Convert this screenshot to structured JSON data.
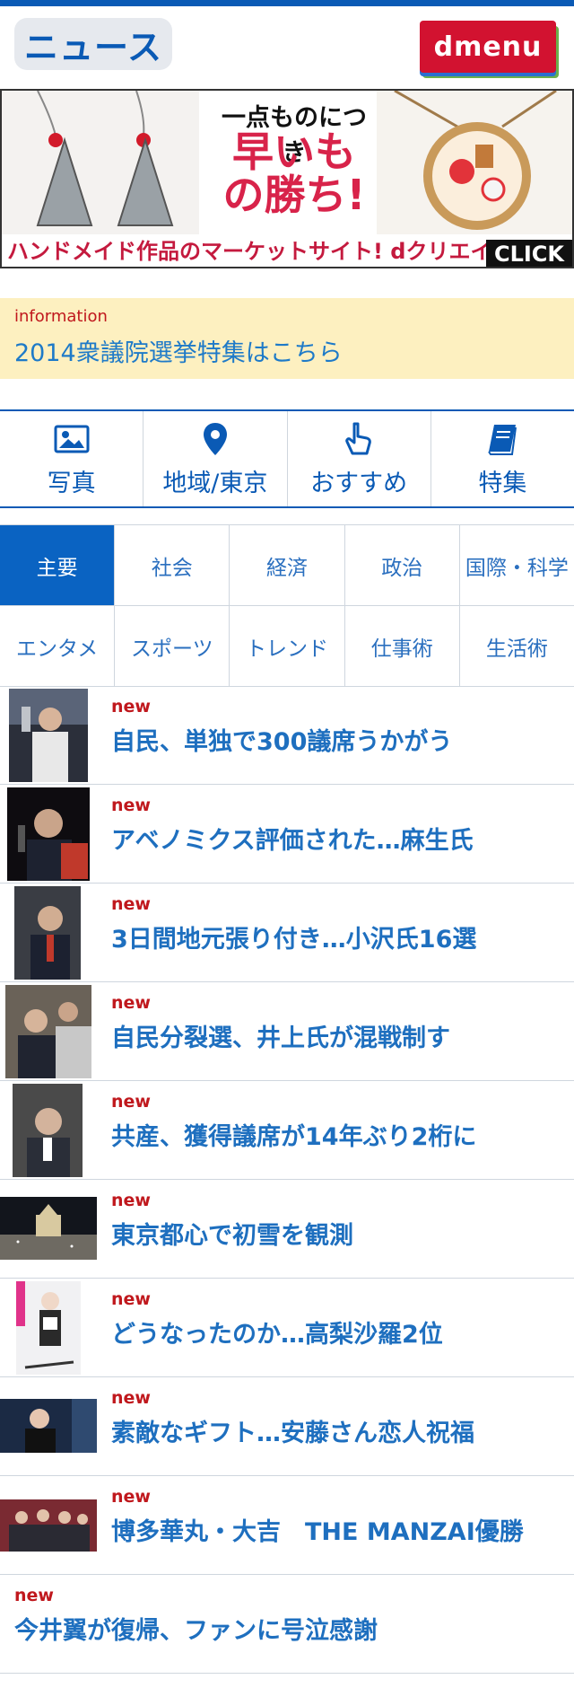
{
  "header": {
    "logo_text": "ニュース",
    "dmenu_label": "dmenu"
  },
  "banner": {
    "line1": "一点ものにつき",
    "line2": "早いもの勝ち!",
    "footer": "ハンドメイド作品のマーケットサイト! dクリエイターズ",
    "click": "CLICK"
  },
  "info": {
    "label": "information",
    "link": "2014衆議院選挙特集はこちら"
  },
  "quick_nav": [
    {
      "label": "写真",
      "icon": "photo-icon"
    },
    {
      "label": "地域/東京",
      "icon": "location-pin-icon"
    },
    {
      "label": "おすすめ",
      "icon": "pointing-hand-icon"
    },
    {
      "label": "特集",
      "icon": "book-icon"
    }
  ],
  "categories": {
    "row1": [
      "主要",
      "社会",
      "経済",
      "政治",
      "国際・科学"
    ],
    "row2": [
      "エンタメ",
      "スポーツ",
      "トレンド",
      "仕事術",
      "生活術"
    ],
    "active": "主要"
  },
  "news": [
    {
      "tag": "new",
      "headline": "自民、単独で300議席うかがう"
    },
    {
      "tag": "new",
      "headline": "アベノミクス評価された…麻生氏"
    },
    {
      "tag": "new",
      "headline": "3日間地元張り付き…小沢氏16選"
    },
    {
      "tag": "new",
      "headline": "自民分裂選、井上氏が混戦制す"
    },
    {
      "tag": "new",
      "headline": "共産、獲得議席が14年ぶり2桁に"
    },
    {
      "tag": "new",
      "headline": "東京都心で初雪を観測"
    },
    {
      "tag": "new",
      "headline": "どうなったのか…高梨沙羅2位"
    },
    {
      "tag": "new",
      "headline": "素敵なギフト…安藤さん恋人祝福"
    },
    {
      "tag": "new",
      "headline": "博多華丸・大吉　THE MANZAI優勝"
    },
    {
      "tag": "new",
      "headline": "今井翼が復帰、ファンに号泣感謝"
    }
  ],
  "colors": {
    "brand_blue": "#0a5ab5",
    "new_red": "#c0181d",
    "info_bg": "#fdf0c0"
  }
}
